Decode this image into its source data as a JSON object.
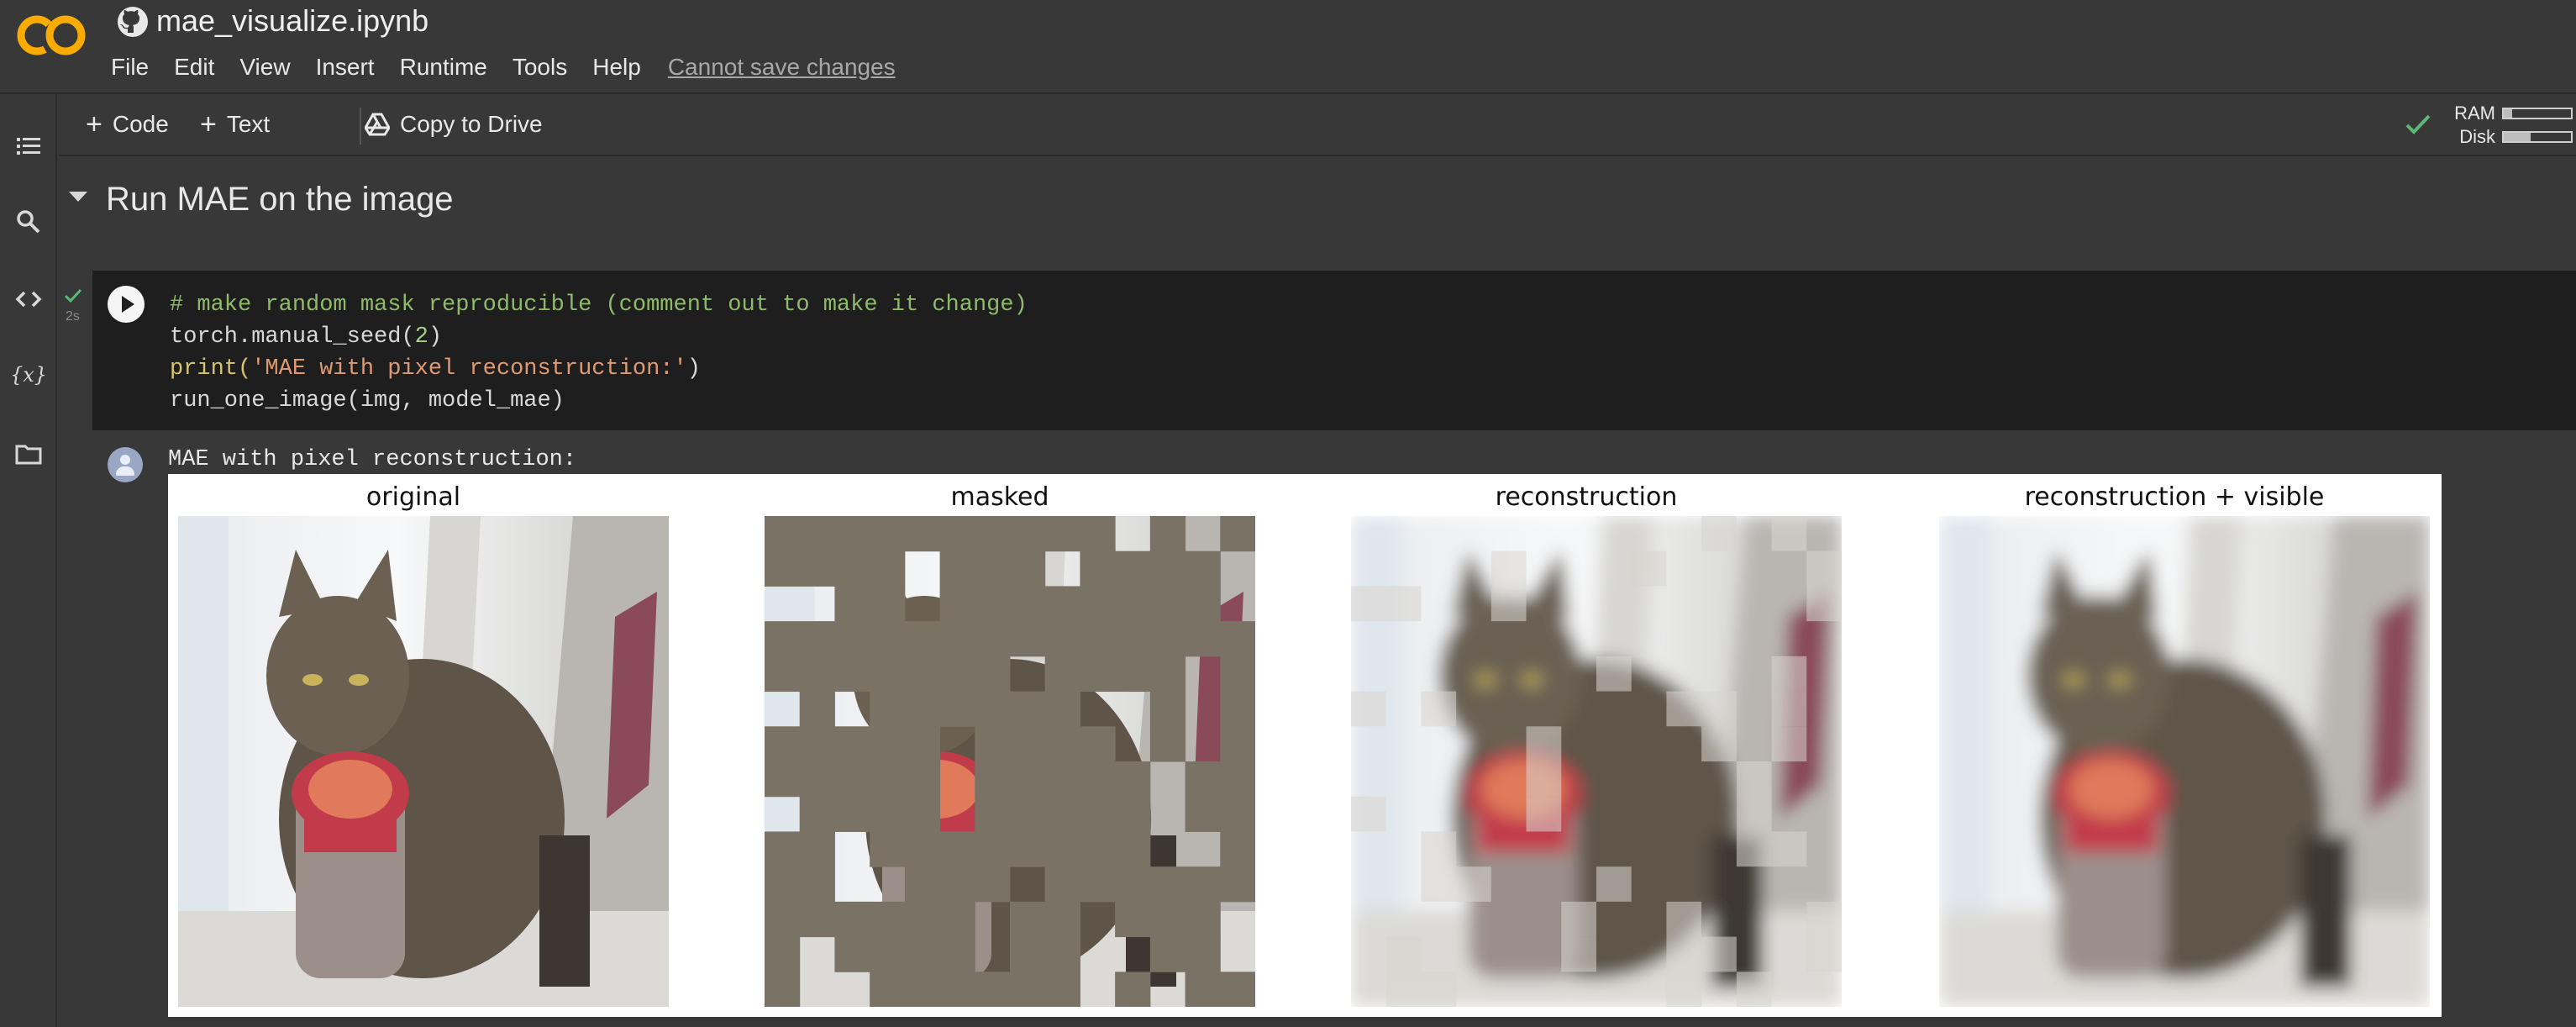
{
  "app": {
    "logo_text": "CO",
    "notebook_title": "mae_visualize.ipynb"
  },
  "menu": {
    "items": [
      "File",
      "Edit",
      "View",
      "Insert",
      "Runtime",
      "Tools",
      "Help"
    ],
    "save_status": "Cannot save changes"
  },
  "toolbar": {
    "code_label": "Code",
    "text_label": "Text",
    "copy_label": "Copy to Drive",
    "ram_label": "RAM",
    "disk_label": "Disk",
    "ram_usage": 0.12,
    "disk_usage": 0.4
  },
  "section": {
    "title": "Run MAE on the image"
  },
  "cell": {
    "exec_time": "2s",
    "lines": {
      "line1": "# make random mask reproducible (comment out to make it change)",
      "line2_fn": "torch.manual_seed(",
      "line2_arg": "2",
      "line2_end": ")",
      "line3_fn": "print(",
      "line3_arg": "'MAE with pixel reconstruction:'",
      "line3_end": ")",
      "line4": "run_one_image(img, model_mae)"
    },
    "output_text": "MAE with pixel reconstruction:"
  },
  "figure": {
    "panels": [
      "original",
      "masked",
      "reconstruction",
      "reconstruction + visible"
    ]
  },
  "colors": {
    "accent_orange": "#f9ab00",
    "check_green": "#5bb974",
    "mask_gray": "#7a7265"
  }
}
